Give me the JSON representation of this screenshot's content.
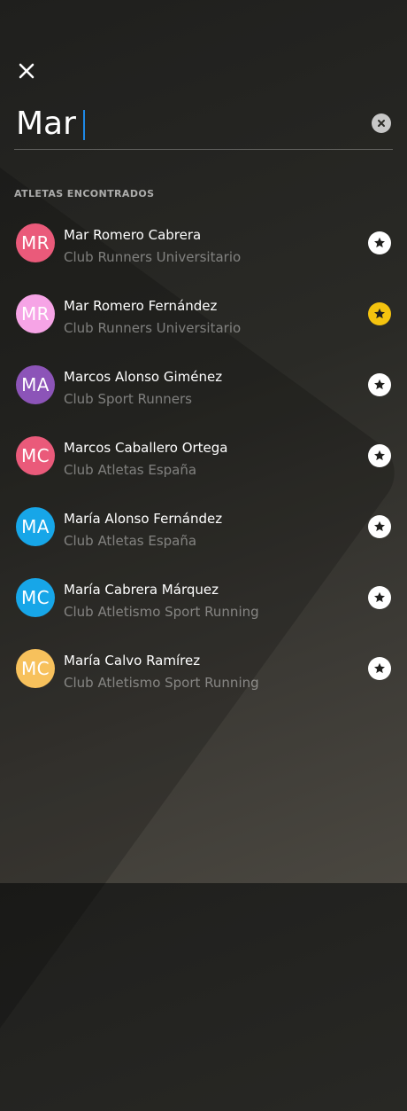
{
  "search": {
    "value": "Mar"
  },
  "section": {
    "title": "ATLETAS ENCONTRADOS"
  },
  "colors": {
    "caret": "#1e88e5",
    "favorite_active": "#f4c30f",
    "favorite_inactive": "#ffffff"
  },
  "athletes": [
    {
      "initials": "MR",
      "name": "Mar Romero Cabrera",
      "club": "Club Runners Universitario",
      "avatar_color": "#ea5a7a",
      "favorite": false
    },
    {
      "initials": "MR",
      "name": "Mar Romero Fernández",
      "club": "Club Runners Universitario",
      "avatar_color": "#f6a4e6",
      "favorite": true
    },
    {
      "initials": "MA",
      "name": "Marcos Alonso Giménez",
      "club": "Club Sport Runners",
      "avatar_color": "#8c54b8",
      "favorite": false
    },
    {
      "initials": "MC",
      "name": "Marcos Caballero Ortega",
      "club": "Club Atletas España",
      "avatar_color": "#ea5a7a",
      "favorite": false
    },
    {
      "initials": "MA",
      "name": "María Alonso Fernández",
      "club": "Club Atletas España",
      "avatar_color": "#17a6e8",
      "favorite": false
    },
    {
      "initials": "MC",
      "name": "María Cabrera Márquez",
      "club": "Club Atletismo Sport Running",
      "avatar_color": "#17a6e8",
      "favorite": false
    },
    {
      "initials": "MC",
      "name": "María Calvo Ramírez",
      "club": "Club Atletismo Sport Running",
      "avatar_color": "#f7c15c",
      "favorite": false
    }
  ]
}
